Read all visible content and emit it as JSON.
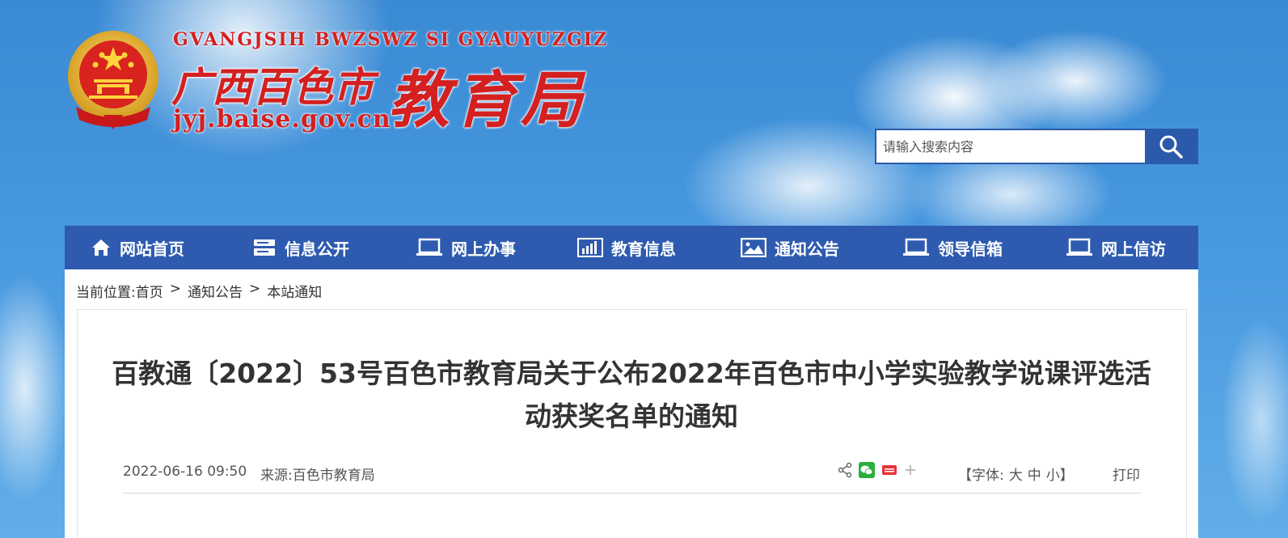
{
  "header": {
    "site_name_pinyin": "GVANGJSIH BWZSWZ SI GYAUYUZGIZ",
    "site_name_city": "广西百色市",
    "site_name_bureau": "教育局",
    "site_domain": "jyj.baise.gov.cn"
  },
  "search": {
    "placeholder": "请输入搜索内容"
  },
  "nav": {
    "items": [
      {
        "label": "网站首页",
        "icon": "home-icon"
      },
      {
        "label": "信息公开",
        "icon": "server-icon"
      },
      {
        "label": "网上办事",
        "icon": "laptop-icon"
      },
      {
        "label": "教育信息",
        "icon": "bar-chart-icon"
      },
      {
        "label": "通知公告",
        "icon": "image-icon"
      },
      {
        "label": "领导信箱",
        "icon": "laptop-icon"
      },
      {
        "label": "网上信访",
        "icon": "laptop-icon"
      }
    ]
  },
  "breadcrumb": {
    "prefix": "当前位置:",
    "items": [
      "首页",
      "通知公告",
      "本站通知"
    ],
    "separator": ">"
  },
  "article": {
    "title": "百教通〔2022〕53号百色市教育局关于公布2022年百色市中小学实验教学说课评选活动获奖名单的通知",
    "date": "2022-06-16 09:50",
    "source": "来源:百色市教育局",
    "font_size_prefix": "【字体:",
    "font_size_large": "大",
    "font_size_medium": "中",
    "font_size_small": "小】",
    "print_label": "打印"
  },
  "colors": {
    "nav_bg": "#2e5bb0",
    "brand_red": "#d42020",
    "search_button": "#2b5aaa"
  }
}
